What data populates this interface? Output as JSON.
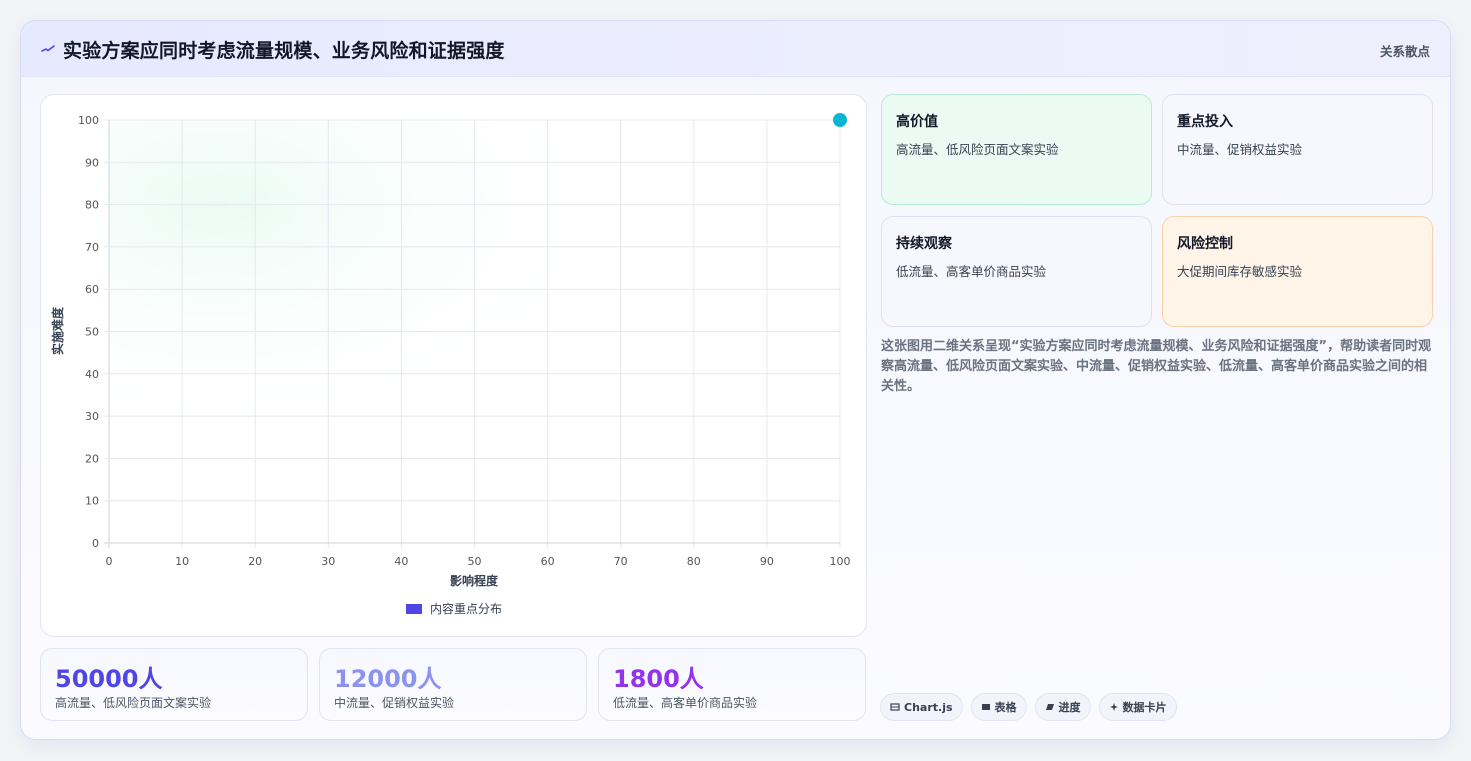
{
  "header": {
    "title": "实验方案应同时考虑流量规模、业务风险和证据强度",
    "tag": "关系散点"
  },
  "chart_data": {
    "type": "scatter",
    "xlabel": "影响程度",
    "ylabel": "实施难度",
    "xlim": [
      0,
      100
    ],
    "ylim": [
      0,
      100
    ],
    "x_ticks": [
      0,
      10,
      20,
      30,
      40,
      50,
      60,
      70,
      80,
      90,
      100
    ],
    "y_ticks": [
      0,
      10,
      20,
      30,
      40,
      50,
      60,
      70,
      80,
      90,
      100
    ],
    "grid": true,
    "legend_position": "bottom",
    "series": [
      {
        "name": "内容重点分布",
        "color": "#06b6d4",
        "legend_color": "#4f46e5",
        "points": [
          {
            "x": 100,
            "y": 100
          }
        ]
      }
    ]
  },
  "stats": [
    {
      "value": "50000人",
      "label": "高流量、低风险页面文案实验",
      "color": "#4f46e5"
    },
    {
      "value": "12000人",
      "label": "中流量、促销权益实验",
      "color": "#8b93ee"
    },
    {
      "value": "1800人",
      "label": "低流量、高客单价商品实验",
      "color": "#9333ea"
    }
  ],
  "quadrants": [
    {
      "title": "高价值",
      "desc": "高流量、低风险页面文案实验"
    },
    {
      "title": "重点投入",
      "desc": "中流量、促销权益实验"
    },
    {
      "title": "持续观察",
      "desc": "低流量、高客单价商品实验"
    },
    {
      "title": "风险控制",
      "desc": "大促期间库存敏感实验"
    }
  ],
  "description": "这张图用二维关系呈现“实验方案应同时考虑流量规模、业务风险和证据强度”，帮助读者同时观察高流量、低风险页面文案实验、中流量、促销权益实验、低流量、高客单价商品实验之间的相关性。",
  "chips": [
    {
      "label": "Chart.js",
      "icon": "chart-icon"
    },
    {
      "label": "表格",
      "icon": "table-icon"
    },
    {
      "label": "进度",
      "icon": "progress-icon"
    },
    {
      "label": "数据卡片",
      "icon": "sparkle-icon"
    }
  ]
}
